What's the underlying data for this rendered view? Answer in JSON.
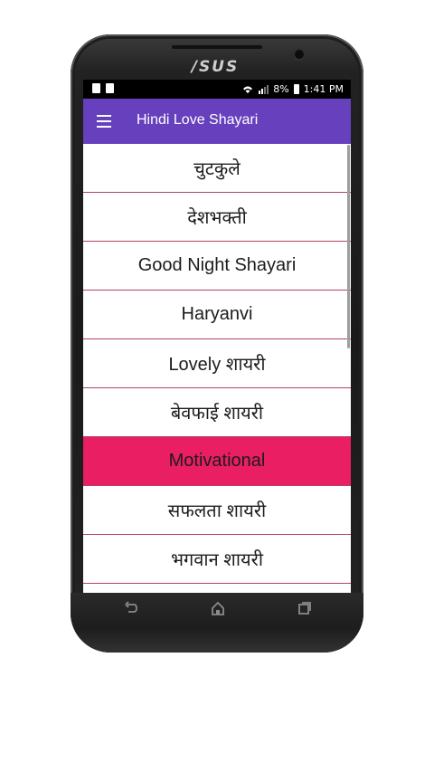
{
  "device": {
    "brand": "/SUS"
  },
  "status_bar": {
    "battery": "8%",
    "time": "1:41 PM"
  },
  "app_bar": {
    "title": "Hindi Love Shayari"
  },
  "list": {
    "items": [
      {
        "label": "चुटकुले"
      },
      {
        "label": "देशभक्ती"
      },
      {
        "label": "Good Night Shayari"
      },
      {
        "label": "Haryanvi"
      },
      {
        "label": "Lovely शायरी"
      },
      {
        "label": "बेवफाई शायरी"
      },
      {
        "label": "Motivational"
      },
      {
        "label": "सफलता शायरी"
      },
      {
        "label": "भगवान शायरी"
      }
    ],
    "active_color": "#e91e63"
  },
  "colors": {
    "app_bar": "#6740bd",
    "divider": "#b3455b"
  },
  "icons": [
    "menu-icon",
    "back-icon",
    "home-icon",
    "recent-apps-icon",
    "wifi-icon",
    "signal-icon",
    "battery-icon"
  ]
}
